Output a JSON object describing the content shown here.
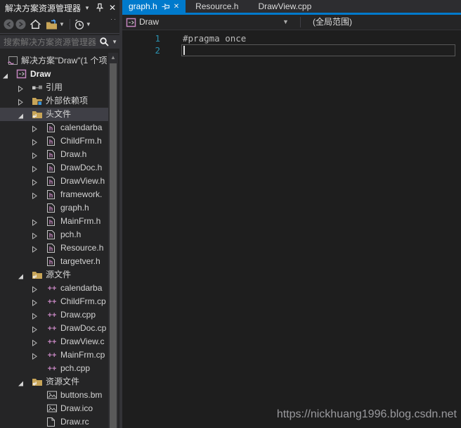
{
  "solution_explorer": {
    "title": "解决方案资源管理器",
    "search_placeholder": "搜索解决方案资源管理器",
    "tree": [
      {
        "label": "解决方案\"Draw\"(1 个项",
        "icon": "solution",
        "level": 0,
        "arrow": "none"
      },
      {
        "label": "Draw",
        "icon": "project",
        "level": 1,
        "arrow": "expanded",
        "bold": true
      },
      {
        "label": "引用",
        "icon": "references",
        "level": 2,
        "arrow": "collapsed"
      },
      {
        "label": "外部依赖项",
        "icon": "ext-deps",
        "level": 2,
        "arrow": "collapsed"
      },
      {
        "label": "头文件",
        "icon": "folder",
        "level": 2,
        "arrow": "expanded",
        "selected": true
      },
      {
        "label": "calendarba",
        "icon": "header",
        "level": 3,
        "arrow": "collapsed"
      },
      {
        "label": "ChildFrm.h",
        "icon": "header",
        "level": 3,
        "arrow": "collapsed"
      },
      {
        "label": "Draw.h",
        "icon": "header",
        "level": 3,
        "arrow": "collapsed"
      },
      {
        "label": "DrawDoc.h",
        "icon": "header",
        "level": 3,
        "arrow": "collapsed"
      },
      {
        "label": "DrawView.h",
        "icon": "header",
        "level": 3,
        "arrow": "collapsed"
      },
      {
        "label": "framework.",
        "icon": "header",
        "level": 3,
        "arrow": "collapsed"
      },
      {
        "label": "graph.h",
        "icon": "header",
        "level": 3,
        "arrow": "none"
      },
      {
        "label": "MainFrm.h",
        "icon": "header",
        "level": 3,
        "arrow": "collapsed"
      },
      {
        "label": "pch.h",
        "icon": "header",
        "level": 3,
        "arrow": "collapsed"
      },
      {
        "label": "Resource.h",
        "icon": "header",
        "level": 3,
        "arrow": "collapsed"
      },
      {
        "label": "targetver.h",
        "icon": "header",
        "level": 3,
        "arrow": "none"
      },
      {
        "label": "源文件",
        "icon": "folder",
        "level": 2,
        "arrow": "expanded"
      },
      {
        "label": "calendarba",
        "icon": "cpp",
        "level": 3,
        "arrow": "collapsed"
      },
      {
        "label": "ChildFrm.cp",
        "icon": "cpp",
        "level": 3,
        "arrow": "collapsed"
      },
      {
        "label": "Draw.cpp",
        "icon": "cpp",
        "level": 3,
        "arrow": "collapsed"
      },
      {
        "label": "DrawDoc.cp",
        "icon": "cpp",
        "level": 3,
        "arrow": "collapsed"
      },
      {
        "label": "DrawView.c",
        "icon": "cpp",
        "level": 3,
        "arrow": "collapsed"
      },
      {
        "label": "MainFrm.cp",
        "icon": "cpp",
        "level": 3,
        "arrow": "collapsed"
      },
      {
        "label": "pch.cpp",
        "icon": "cpp",
        "level": 3,
        "arrow": "none"
      },
      {
        "label": "资源文件",
        "icon": "folder",
        "level": 2,
        "arrow": "expanded"
      },
      {
        "label": "buttons.bm",
        "icon": "image",
        "level": 3,
        "arrow": "none"
      },
      {
        "label": "Draw.ico",
        "icon": "image",
        "level": 3,
        "arrow": "none"
      },
      {
        "label": "Draw.rc",
        "icon": "rcdoc",
        "level": 3,
        "arrow": "none"
      }
    ]
  },
  "editor": {
    "tabs": [
      {
        "label": "graph.h",
        "active": true,
        "pinned": true
      },
      {
        "label": "Resource.h",
        "active": false,
        "pinned": false
      },
      {
        "label": "DrawView.cpp",
        "active": false,
        "pinned": false
      }
    ],
    "navbar": {
      "type_dropdown": "Draw",
      "scope_dropdown": "(全局范围)"
    },
    "code": {
      "lines": [
        {
          "number": "1",
          "text": "#pragma once"
        },
        {
          "number": "2",
          "text": ""
        }
      ]
    },
    "watermark": "https://nickhuang1996.blog.csdn.net"
  },
  "colors": {
    "accent": "#007ACC",
    "editor_bg": "#1E1E1E",
    "panel_bg": "#252526",
    "selection_bg": "#3F3F46",
    "line_number": "#2B91AF",
    "folder_icon": "#C8A558",
    "code_symbol": "#C586C0"
  }
}
